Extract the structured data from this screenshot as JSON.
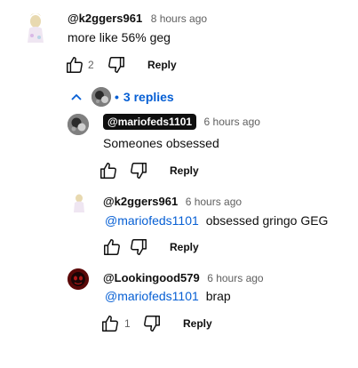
{
  "comments": [
    {
      "handle": "@k2ggers961",
      "time": "8 hours ago",
      "text": "more like 56% geg",
      "likes": "2",
      "reply_label": "Reply"
    }
  ],
  "thread": {
    "replies_label": "3 replies",
    "bullet": "•",
    "replies": [
      {
        "handle": "@mariofeds1101",
        "time": "6 hours ago",
        "text": "Someones obsessed",
        "reply_label": "Reply",
        "highlighted_handle": true
      },
      {
        "handle": "@k2ggers961",
        "time": "6 hours ago",
        "mention": "@mariofeds1101",
        "text": "obsessed gringo GEG",
        "reply_label": "Reply"
      },
      {
        "handle": "@Lookingood579",
        "time": "6 hours ago",
        "mention": "@mariofeds1101",
        "text": "brap",
        "likes": "1",
        "reply_label": "Reply"
      }
    ]
  },
  "colors": {
    "link": "#065fd4",
    "meta": "#606060"
  },
  "icons": [
    "thumb-up-icon",
    "thumb-down-icon",
    "chevron-up-icon"
  ]
}
